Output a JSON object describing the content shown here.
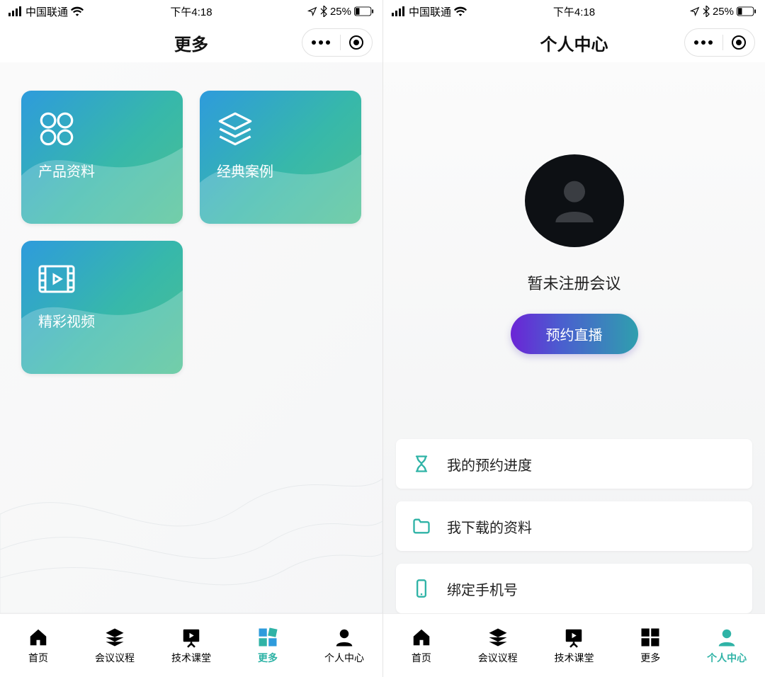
{
  "status": {
    "carrier": "中国联通",
    "time": "下午4:18",
    "battery_pct": "25%"
  },
  "left": {
    "title": "更多",
    "cards": [
      {
        "label": "产品资料",
        "icon": "grid-apps"
      },
      {
        "label": "经典案例",
        "icon": "layers"
      },
      {
        "label": "精彩视频",
        "icon": "video-film"
      }
    ]
  },
  "right": {
    "title": "个人中心",
    "profile": {
      "status_text": "暂未注册会议",
      "cta_label": "预约直播"
    },
    "menu": [
      {
        "label": "我的预约进度",
        "icon": "hourglass"
      },
      {
        "label": "我下载的资料",
        "icon": "folder"
      },
      {
        "label": "绑定手机号",
        "icon": "phone"
      }
    ]
  },
  "tabs": [
    {
      "label": "首页",
      "icon": "home"
    },
    {
      "label": "会议议程",
      "icon": "stack"
    },
    {
      "label": "技术课堂",
      "icon": "presentation"
    },
    {
      "label": "更多",
      "icon": "tiles"
    },
    {
      "label": "个人中心",
      "icon": "person"
    }
  ],
  "colors": {
    "accent": "#2fb3a6",
    "cta_start": "#6b24d6",
    "cta_end": "#2f9fae"
  }
}
